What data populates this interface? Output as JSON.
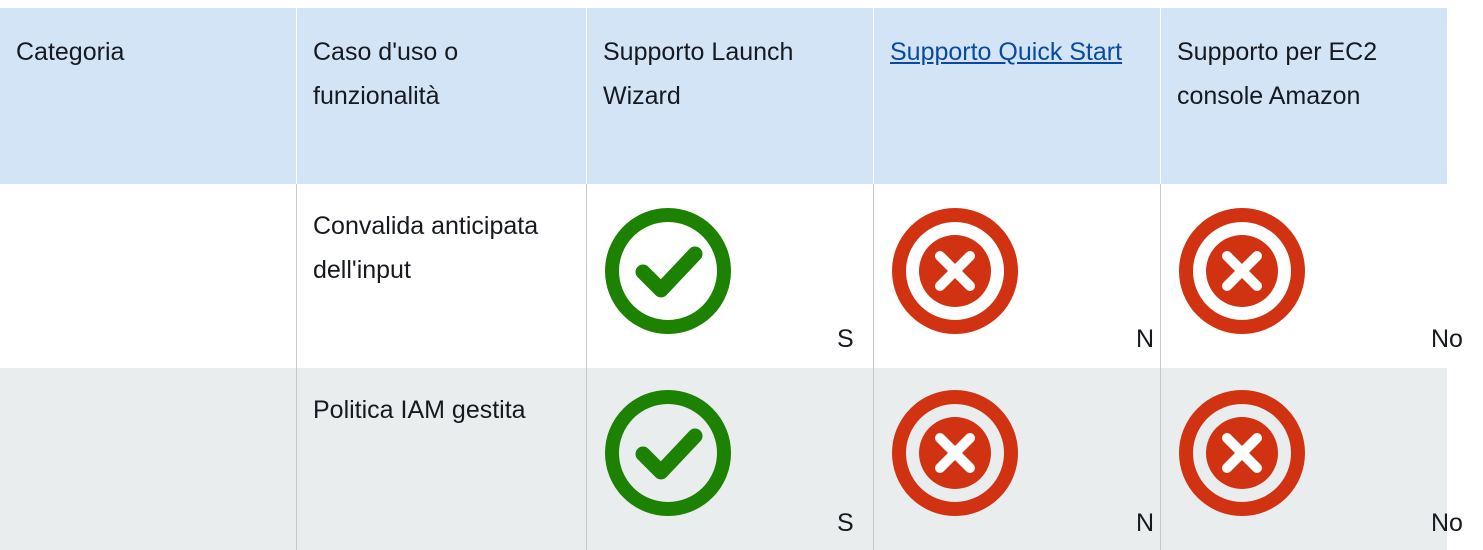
{
  "header": {
    "col1": "Categoria",
    "col2": "Caso d'uso o funzionalità",
    "col3": "Supporto Launch Wizard",
    "col4": "Supporto Quick Start",
    "col5": "Supporto per EC2 console Amazon"
  },
  "rows": [
    {
      "category": "",
      "feature": "Convalida anticipata dell'input",
      "launch_wizard": "S",
      "launch_wizard_icon": "check-circle-icon",
      "quick_start": "N",
      "quick_start_icon": "x-circle-icon",
      "ec2_console": "No",
      "ec2_console_icon": "x-circle-icon"
    },
    {
      "category": "",
      "feature": "Politica IAM gestita",
      "launch_wizard": "S",
      "launch_wizard_icon": "check-circle-icon",
      "quick_start": "N",
      "quick_start_icon": "x-circle-icon",
      "ec2_console": "No",
      "ec2_console_icon": "x-circle-icon"
    }
  ],
  "colors": {
    "header_bg": "#d4e4f7",
    "alt_row_bg": "#eaeded",
    "check_green": "#1d8102",
    "x_red": "#d13212",
    "link": "#0a4a9e"
  }
}
